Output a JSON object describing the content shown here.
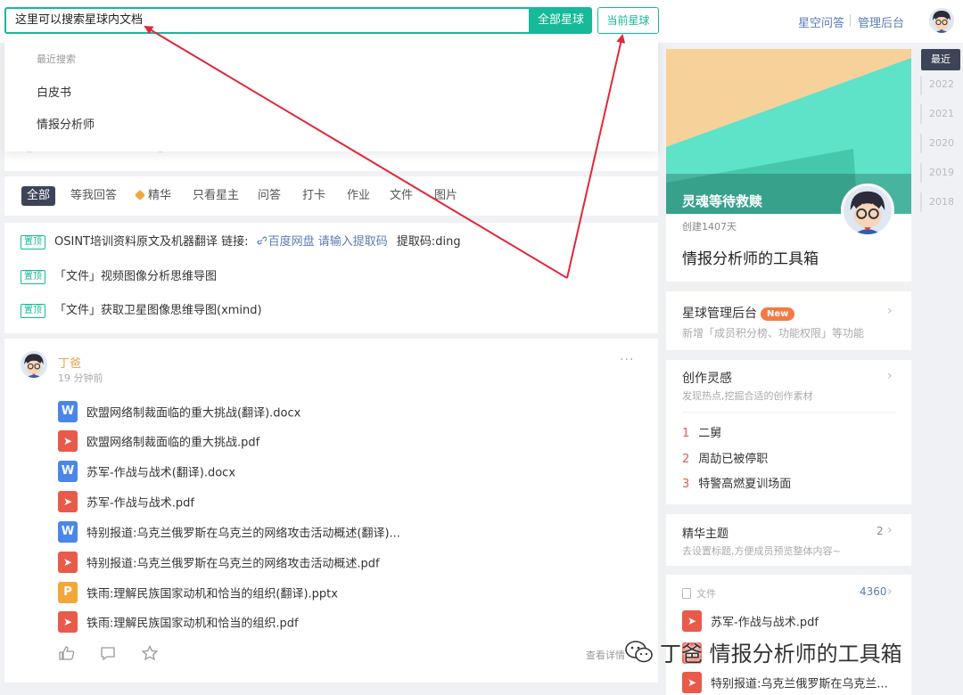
{
  "search": {
    "query": "这里可以搜索星球内文档",
    "btn_all": "全部星球",
    "btn_current": "当前星球"
  },
  "top_nav": {
    "qa": "星空问答",
    "admin": "管理后台"
  },
  "recent": {
    "title": "最近搜索",
    "items": [
      "白皮书",
      "情报分析师"
    ]
  },
  "filters": [
    "全部",
    "等我回答",
    "精华",
    "只看星主",
    "问答",
    "打卡",
    "作业",
    "文件",
    "图片"
  ],
  "pinned": {
    "tag": "置顶",
    "rows": [
      {
        "text": "OSINT培训资料原文及机器翻译 链接:",
        "link": "百度网盘 请输入提取码",
        "tail": "提取码:ding"
      },
      {
        "text": "「文件」视频图像分析思维导图"
      },
      {
        "text": "「文件」获取卫星图像思维导图(xmind)"
      }
    ]
  },
  "post": {
    "author": "丁爸",
    "time": "19 分钟前",
    "more": "···",
    "files": [
      {
        "type": "doc",
        "icon_letter": "W",
        "name": "欧盟网络制裁面临的重大挑战(翻译).docx"
      },
      {
        "type": "pdf",
        "icon_letter": "➤",
        "name": "欧盟网络制裁面临的重大挑战.pdf"
      },
      {
        "type": "doc",
        "icon_letter": "W",
        "name": "苏军-作战与战术(翻译).docx"
      },
      {
        "type": "pdf",
        "icon_letter": "➤",
        "name": "苏军-作战与战术.pdf"
      },
      {
        "type": "doc",
        "icon_letter": "W",
        "name": "特别报道:乌克兰俄罗斯在乌克兰的网络攻击活动概述(翻译)..."
      },
      {
        "type": "pdf",
        "icon_letter": "➤",
        "name": "特别报道:乌克兰俄罗斯在乌克兰的网络攻击活动概述.pdf"
      },
      {
        "type": "ppt",
        "icon_letter": "P",
        "name": "铁雨:理解民族国家动机和恰当的组织(翻译).pptx"
      },
      {
        "type": "pdf",
        "icon_letter": "➤",
        "name": "铁雨:理解民族国家动机和恰当的组织.pdf"
      }
    ],
    "detail": "查看详情"
  },
  "group": {
    "banner_text": "灵魂等待救赎",
    "days": "创建1407天",
    "name": "情报分析师的工具箱"
  },
  "admin_card": {
    "title": "星球管理后台",
    "badge": "New",
    "sub": "新增「成员积分榜、功能权限」等功能"
  },
  "inspire": {
    "title": "创作灵感",
    "sub": "发现热点,挖掘合适的创作素材",
    "items": [
      {
        "num": "1",
        "text": "二舅"
      },
      {
        "num": "2",
        "text": "周劼已被停职"
      },
      {
        "num": "3",
        "text": "特警高燃夏训场面"
      }
    ]
  },
  "essence": {
    "title": "精华主题",
    "sub": "去设置标题,方便成员预览整体内容~",
    "count": "2"
  },
  "files_card": {
    "label": "文件",
    "count": "4360",
    "items": [
      "苏军-作战与战术.pdf",
      "",
      "特别报道:乌克兰俄罗斯在乌克兰..."
    ]
  },
  "years": {
    "active": "最近",
    "list": [
      "2022",
      "2021",
      "2020",
      "2019",
      "2018"
    ]
  },
  "watermark": "丁爸 情报分析师的工具箱",
  "colors": {
    "accent": "#16b998",
    "arrow": "#e0283a",
    "dark": "#3d4459",
    "link": "#5a7db3"
  }
}
